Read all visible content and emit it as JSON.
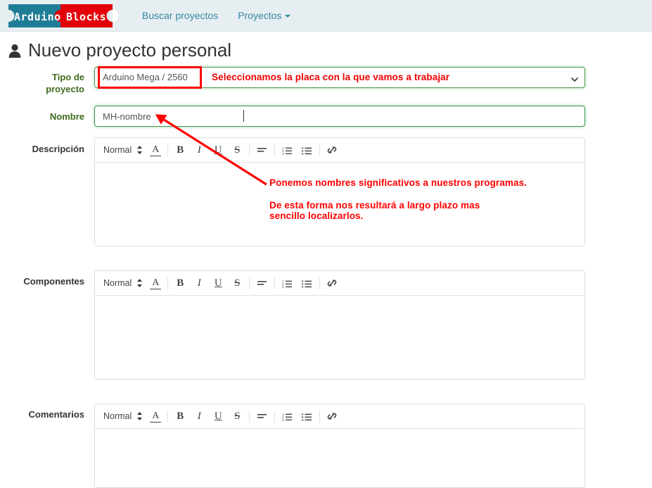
{
  "navbar": {
    "brand": {
      "part1": "Arduino",
      "part2": "Blocks",
      "color_teal": "#1f7d96",
      "color_red": "#e3000b"
    },
    "links": [
      {
        "label": "Buscar proyectos",
        "has_caret": false
      },
      {
        "label": "Proyectos",
        "has_caret": true
      }
    ],
    "background": "#e7eef1",
    "link_color": "#3388a3"
  },
  "page": {
    "title": "Nuevo proyecto personal",
    "title_icon": "user-icon"
  },
  "form": {
    "tipo": {
      "label": "Tipo de proyecto",
      "value": "Arduino Mega / 2560",
      "chevron_icon": "chevron-down-icon"
    },
    "nombre": {
      "label": "Nombre",
      "value": "MH-nombre",
      "placeholder": "Nombre"
    },
    "descripcion": {
      "label": "Descripción"
    },
    "componentes": {
      "label": "Componentes"
    },
    "comentarios": {
      "label": "Comentarios"
    }
  },
  "toolbar": {
    "format_label": "Normal",
    "items": [
      {
        "name": "format-select",
        "glyph": "Normal"
      },
      {
        "name": "font-color-icon",
        "glyph": "A"
      },
      {
        "name": "bold-icon",
        "glyph": "B"
      },
      {
        "name": "italic-icon",
        "glyph": "I"
      },
      {
        "name": "underline-icon",
        "glyph": "U"
      },
      {
        "name": "strikethrough-icon",
        "glyph": "S"
      },
      {
        "name": "align-icon",
        "glyph": "align"
      },
      {
        "name": "ordered-list-icon",
        "glyph": "ol"
      },
      {
        "name": "unordered-list-icon",
        "glyph": "ul"
      },
      {
        "name": "link-icon",
        "glyph": "link"
      }
    ]
  },
  "annotations": {
    "color": "#ff0000",
    "board_note": "Seleccionamos la placa con la que vamos a trabajar",
    "name_note_line1": "Ponemos nombres significativos a nuestros programas.",
    "name_note_line2": "De esta forma nos resultará a largo plazo mas",
    "name_note_line3": "sencillo localizarlos.",
    "highlight_box_target": "Arduino Mega / 2560",
    "arrow_target": "nombre-input"
  }
}
